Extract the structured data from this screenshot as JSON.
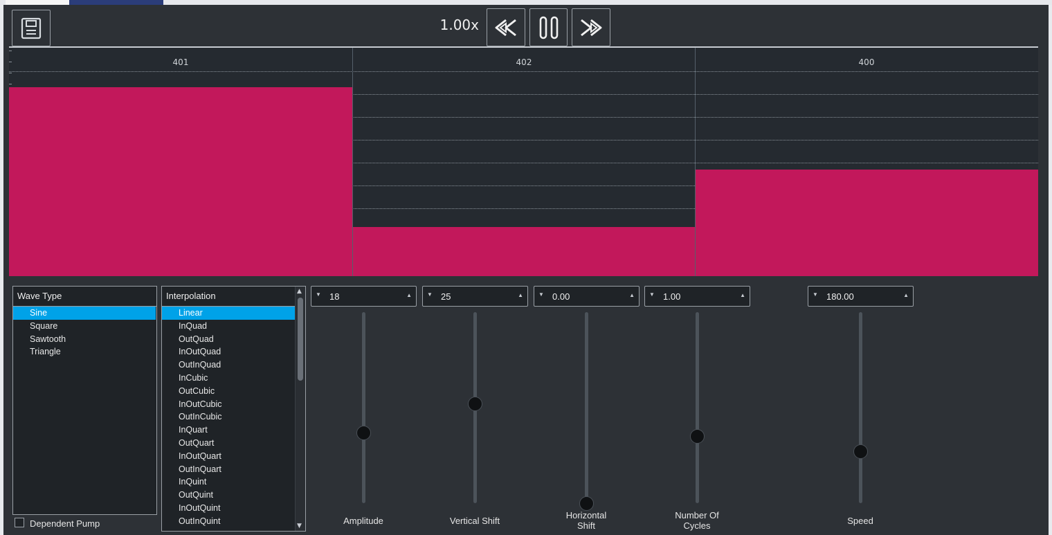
{
  "toolbar": {
    "speed_label": "1.00x",
    "save_icon": "save-icon",
    "rewind_icon": "rewind-icon",
    "pause_icon": "pause-icon",
    "forward_icon": "fast-forward-icon"
  },
  "timeline": {
    "segments": [
      {
        "label": "401",
        "level": 0.92
      },
      {
        "label": "402",
        "level": 0.24
      },
      {
        "label": "400",
        "level": 0.52
      }
    ],
    "bar_color": "#c2185b"
  },
  "wave_type": {
    "header": "Wave Type",
    "items": [
      "Sine",
      "Square",
      "Sawtooth",
      "Triangle"
    ],
    "selected": "Sine"
  },
  "interpolation": {
    "header": "Interpolation",
    "items": [
      "Linear",
      "InQuad",
      "OutQuad",
      "InOutQuad",
      "OutInQuad",
      "InCubic",
      "OutCubic",
      "InOutCubic",
      "OutInCubic",
      "InQuart",
      "OutQuart",
      "InOutQuart",
      "OutInQuart",
      "InQuint",
      "OutQuint",
      "InOutQuint",
      "OutInQuint"
    ],
    "selected": "Linear"
  },
  "controls": [
    {
      "label": "Amplitude",
      "value": "18",
      "level": 0.37
    },
    {
      "label": "Vertical Shift",
      "value": "25",
      "level": 0.52
    },
    {
      "label": "Horizontal Shift",
      "value": "0.00",
      "level": 0.0
    },
    {
      "label": "Number Of Cycles",
      "value": "1.00",
      "level": 0.35
    },
    {
      "label": "Speed",
      "value": "180.00",
      "level": 0.27
    }
  ],
  "dependent_pump": {
    "label": "Dependent Pump",
    "checked": false
  },
  "colors": {
    "accent": "#00a2e8",
    "background": "#2d3136",
    "panel": "#1f2327"
  }
}
